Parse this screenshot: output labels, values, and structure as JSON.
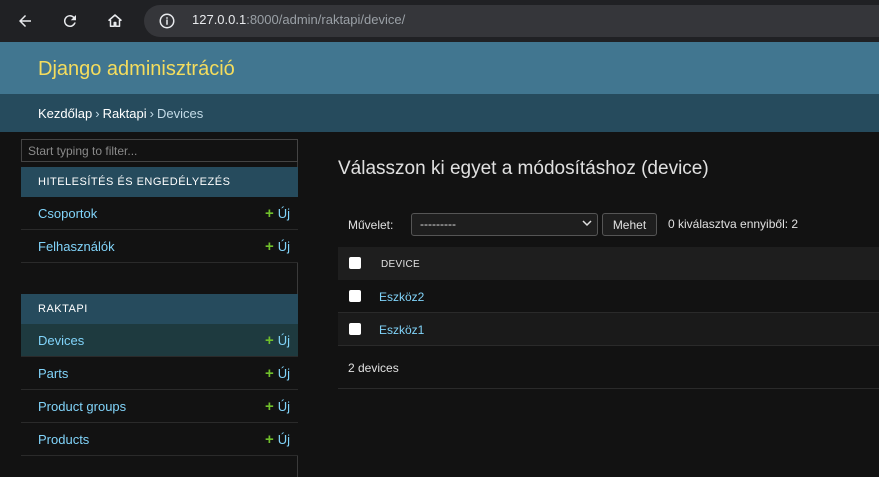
{
  "browser": {
    "url_host": "127.0.0.1",
    "url_rest": ":8000/admin/raktapi/device/"
  },
  "header": {
    "branding": "Django adminisztráció"
  },
  "breadcrumbs": {
    "home": "Kezdőlap",
    "app": "Raktapi",
    "current": "Devices"
  },
  "sidebar": {
    "filter_placeholder": "Start typing to filter...",
    "modules": [
      {
        "caption": "HITELESÍTÉS ÉS ENGEDÉLYEZÉS",
        "items": [
          {
            "label": "Csoportok",
            "add": "Új"
          },
          {
            "label": "Felhasználók",
            "add": "Új"
          }
        ]
      },
      {
        "caption": "RAKTAPI",
        "items": [
          {
            "label": "Devices",
            "add": "Új"
          },
          {
            "label": "Parts",
            "add": "Új"
          },
          {
            "label": "Product groups",
            "add": "Új"
          },
          {
            "label": "Products",
            "add": "Új"
          }
        ]
      }
    ]
  },
  "content": {
    "title": "Válasszon ki egyet a módosításhoz (device)",
    "action_label": "Művelet:",
    "action_selected": "---------",
    "go_button": "Mehet",
    "counter": "0 kiválasztva ennyiből: 2",
    "column_header": "DEVICE",
    "rows": [
      {
        "name": "Eszköz2"
      },
      {
        "name": "Eszköz1"
      }
    ],
    "paginator": "2 devices"
  },
  "colors": {
    "header_bg": "#417690",
    "branding": "#f5dd5d",
    "breadcrumbs_bg": "#264b5d",
    "link": "#81d4fa",
    "add_plus": "#70bf2b"
  }
}
